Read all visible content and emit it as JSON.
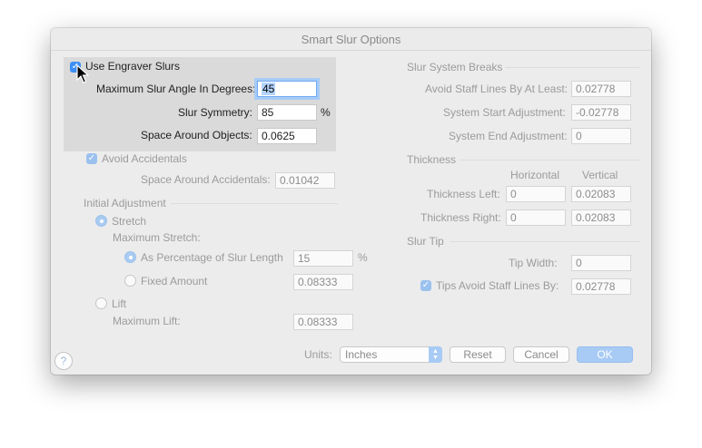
{
  "window": {
    "title": "Smart Slur Options"
  },
  "left": {
    "use_engraver_slurs": {
      "label": "Use Engraver Slurs",
      "checked": true
    },
    "max_angle": {
      "label": "Maximum Slur Angle In Degrees:",
      "value": "45"
    },
    "symmetry": {
      "label": "Slur Symmetry:",
      "value": "85",
      "unit": "%"
    },
    "space_around_objects": {
      "label": "Space Around Objects:",
      "value": "0.0625"
    },
    "avoid_accidentals": {
      "label": "Avoid Accidentals",
      "checked": true
    },
    "space_around_accidentals": {
      "label": "Space Around Accidentals:",
      "value": "0.01042"
    },
    "initial_adjustment": {
      "heading": "Initial Adjustment",
      "stretch": {
        "label": "Stretch",
        "selected": true
      },
      "maximum_stretch": {
        "label": "Maximum Stretch:"
      },
      "as_percentage": {
        "label": "As Percentage of Slur Length",
        "value": "15",
        "unit": "%",
        "selected": true
      },
      "fixed_amount": {
        "label": "Fixed Amount",
        "value": "0.08333",
        "selected": false
      },
      "lift": {
        "label": "Lift",
        "selected": false
      },
      "maximum_lift": {
        "label": "Maximum Lift:",
        "value": "0.08333"
      }
    }
  },
  "right": {
    "system_breaks": {
      "heading": "Slur System Breaks",
      "avoid_staff_lines": {
        "label": "Avoid Staff Lines By At Least:",
        "value": "0.02778"
      },
      "system_start": {
        "label": "System Start Adjustment:",
        "value": "-0.02778"
      },
      "system_end": {
        "label": "System End Adjustment:",
        "value": "0"
      }
    },
    "thickness": {
      "heading": "Thickness",
      "col_horizontal": "Horizontal",
      "col_vertical": "Vertical",
      "left": {
        "label": "Thickness Left:",
        "horizontal": "0",
        "vertical": "0.02083"
      },
      "right": {
        "label": "Thickness Right:",
        "horizontal": "0",
        "vertical": "0.02083"
      }
    },
    "slur_tip": {
      "heading": "Slur Tip",
      "tip_width": {
        "label": "Tip Width:",
        "value": "0"
      },
      "tips_avoid": {
        "label": "Tips Avoid Staff Lines By:",
        "value": "0.02778",
        "checked": true
      }
    }
  },
  "footer": {
    "help": "?",
    "units_label": "Units:",
    "units_value": "Inches",
    "reset": "Reset",
    "cancel": "Cancel",
    "ok": "OK"
  },
  "colors": {
    "accent": "#3d8ff5",
    "accent_dim": "#a8cbf5",
    "dialog_bg": "#ececec"
  }
}
